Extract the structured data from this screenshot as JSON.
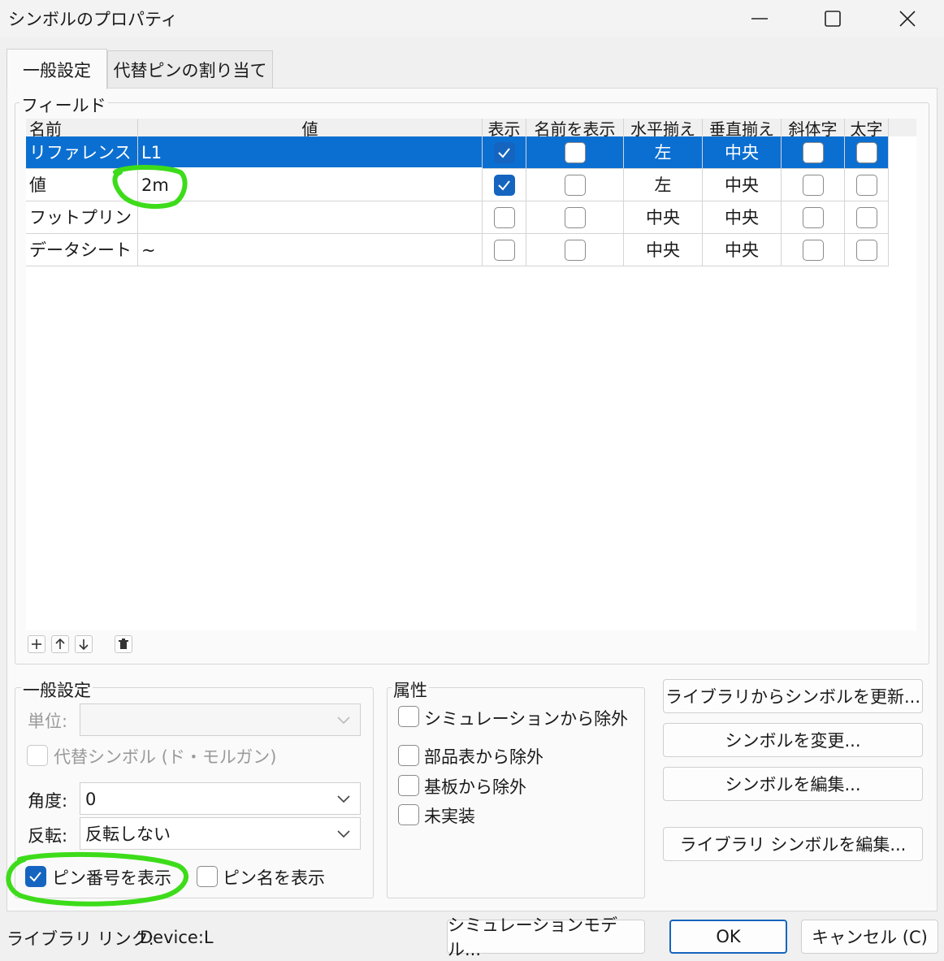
{
  "window": {
    "title": "シンボルのプロパティ"
  },
  "tabs": [
    "一般設定",
    "代替ピンの割り当て"
  ],
  "fields": {
    "group_label": "フィールド",
    "headers": [
      "名前",
      "値",
      "表示",
      "名前を表示",
      "水平揃え",
      "垂直揃え",
      "斜体字",
      "太字"
    ],
    "rows": [
      {
        "name": "リファレンス",
        "value": "L1",
        "show": true,
        "show_name": false,
        "h_align": "左",
        "v_align": "中央",
        "italic": false,
        "bold": false,
        "selected": true
      },
      {
        "name": "値",
        "value": "2m",
        "show": true,
        "show_name": false,
        "h_align": "左",
        "v_align": "中央",
        "italic": false,
        "bold": false,
        "selected": false
      },
      {
        "name": "フットプリント",
        "value": "",
        "show": false,
        "show_name": false,
        "h_align": "中央",
        "v_align": "中央",
        "italic": false,
        "bold": false,
        "selected": false
      },
      {
        "name": "データシート",
        "value": "~",
        "show": false,
        "show_name": false,
        "h_align": "中央",
        "v_align": "中央",
        "italic": false,
        "bold": false,
        "selected": false
      }
    ]
  },
  "general": {
    "group_label": "一般設定",
    "unit_label": "単位:",
    "unit_value": "",
    "alt_symbol_label": "代替シンボル (ド・モルガン)",
    "angle_label": "角度:",
    "angle_value": "0",
    "mirror_label": "反転:",
    "mirror_value": "反転しない",
    "show_pin_numbers_label": "ピン番号を表示",
    "show_pin_numbers": true,
    "show_pin_names_label": "ピン名を表示",
    "show_pin_names": false
  },
  "attributes": {
    "group_label": "属性",
    "exclude_sim": "シミュレーションから除外",
    "exclude_bom": "部品表から除外",
    "exclude_board": "基板から除外",
    "dnp": "未実装"
  },
  "actions": {
    "update_from_lib": "ライブラリからシンボルを更新...",
    "change_symbol": "シンボルを変更...",
    "edit_symbol": "シンボルを編集...",
    "edit_lib_symbol": "ライブラリ シンボルを編集..."
  },
  "footer": {
    "lib_link_label": "ライブラリ リンク:",
    "lib_link_value": "Device:L",
    "sim_model": "シミュレーションモデル...",
    "ok": "OK",
    "cancel": "キャンセル (C)"
  },
  "colors": {
    "selection": "#0b6fd1",
    "checkbox_on": "#1565c0",
    "annotation": "#3ddc1a"
  }
}
